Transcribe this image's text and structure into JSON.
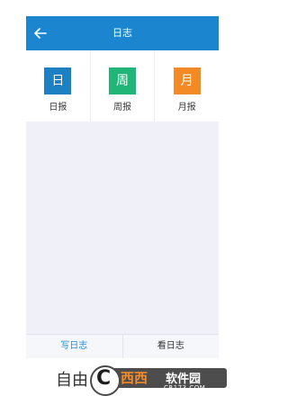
{
  "header": {
    "title": "日志",
    "back_icon": "arrow-left-icon",
    "background_color": "#1b86cf"
  },
  "cards": [
    {
      "badge": "日",
      "label": "日报",
      "color": "#1b80c4"
    },
    {
      "badge": "周",
      "label": "周报",
      "color": "#21b578"
    },
    {
      "badge": "月",
      "label": "月报",
      "color": "#f48a26"
    }
  ],
  "tabs": [
    {
      "label": "写日志",
      "active": true,
      "color": "#2a8bd3"
    },
    {
      "label": "看日志",
      "active": false,
      "color": "#333333"
    }
  ],
  "caption": "自由",
  "watermark": {
    "icon_letter": "C",
    "brand": "西西",
    "suffix": "软件园",
    "url": "CR173.COM"
  }
}
